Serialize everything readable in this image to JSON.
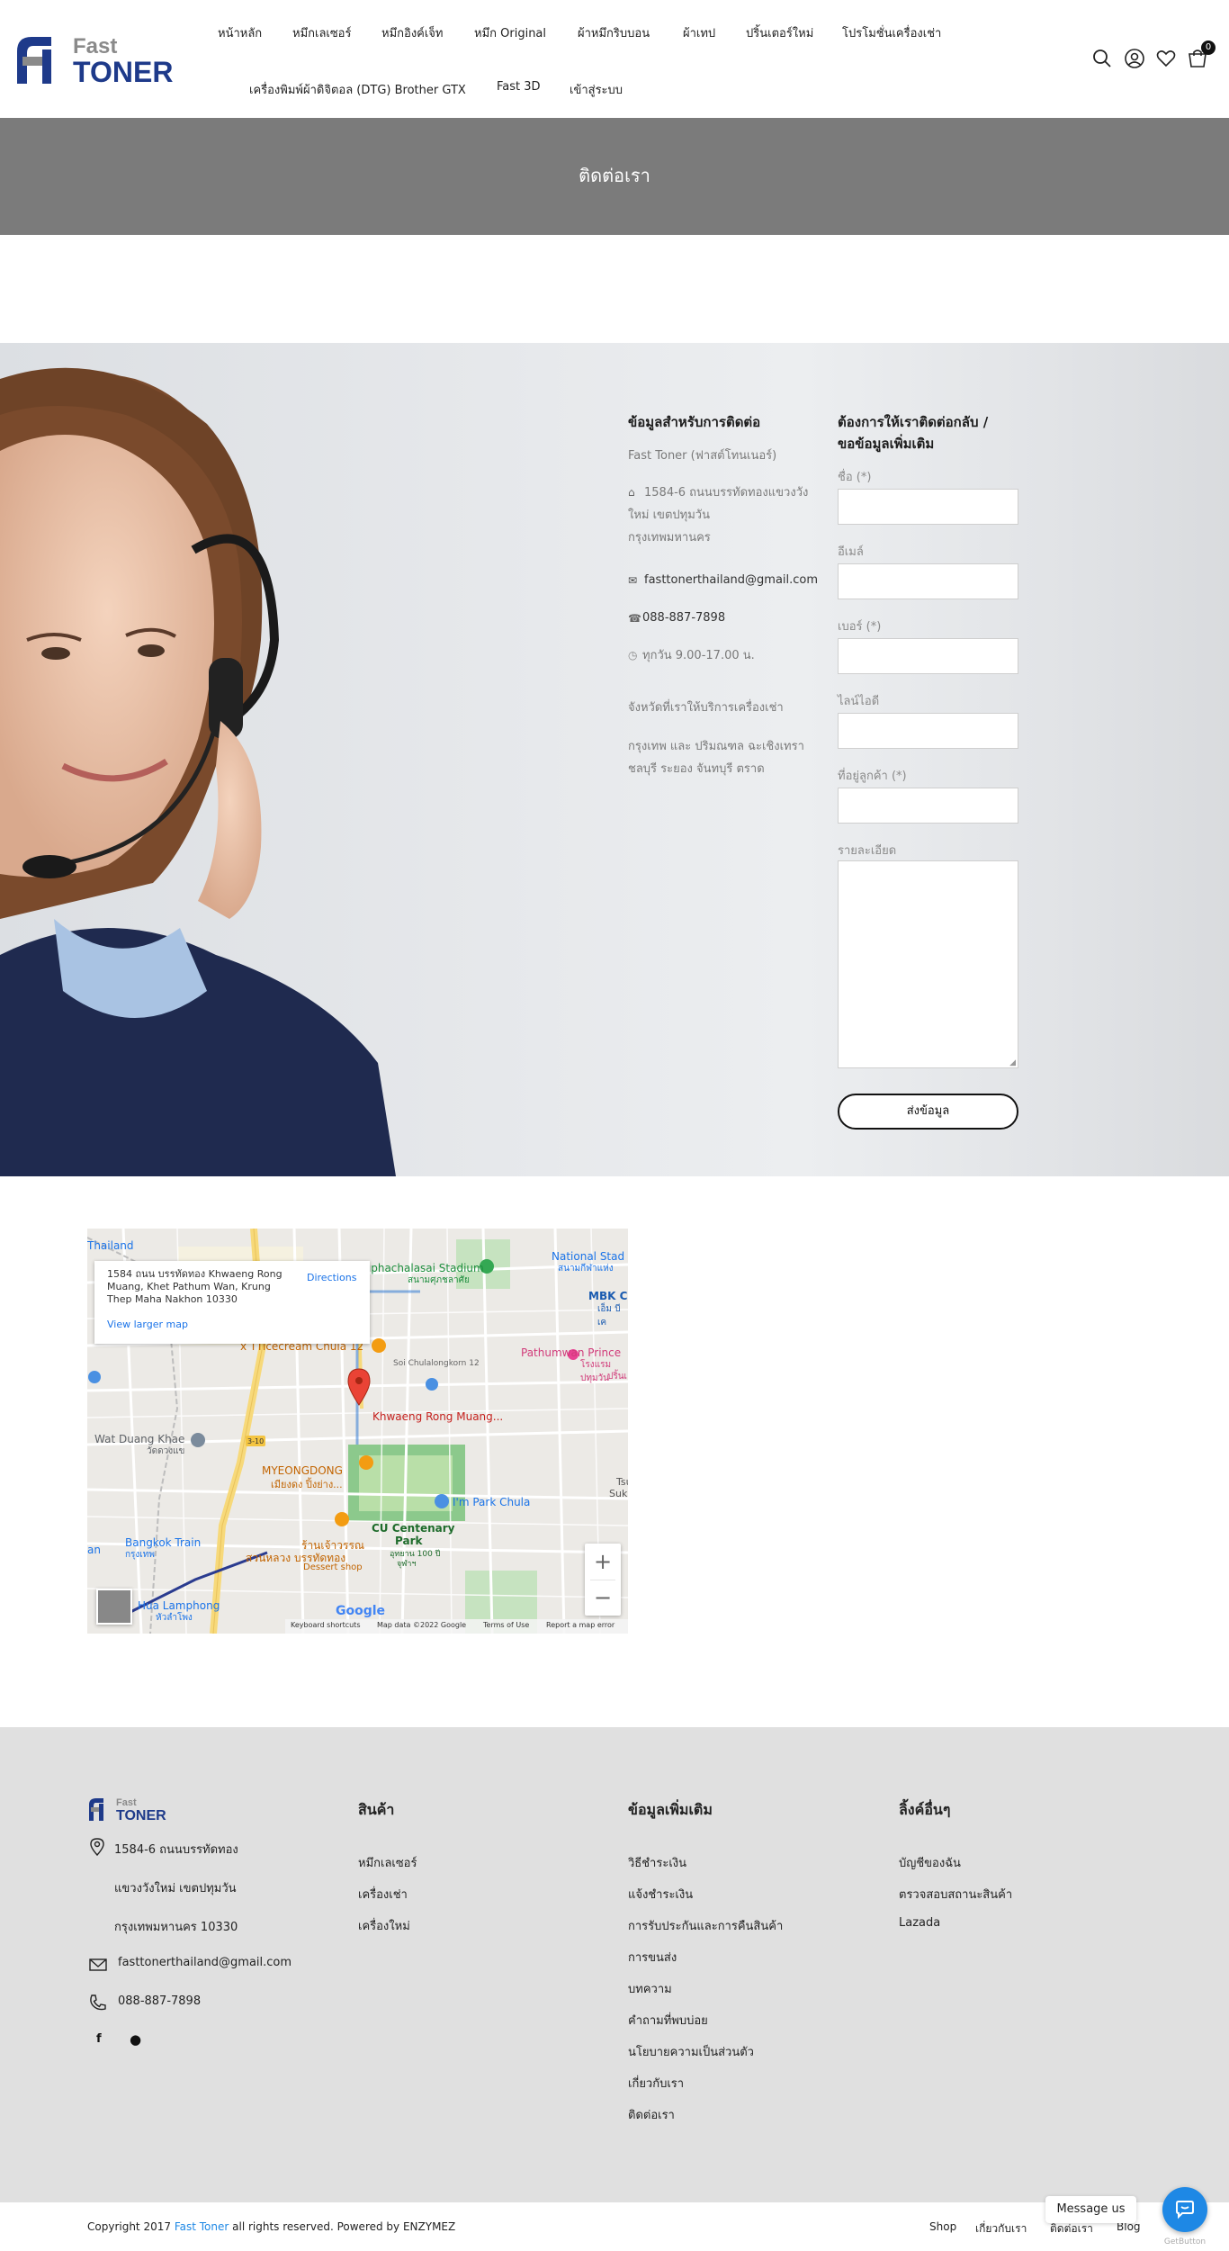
{
  "brand": {
    "logo_top": "Fast",
    "logo_bottom": "TONER",
    "accent": "#1e3a8a",
    "gray": "#8a8a8a"
  },
  "nav": {
    "row1": [
      "หน้าหลัก",
      "หมึกเลเซอร์",
      "หมึกอิงค์เจ็ท",
      "หมึก Original",
      "ผ้าหมึกริบบอน",
      "ผ้าเทป",
      "ปริ้นเตอร์ใหม่",
      "โปรโมชั่นเครื่องเช่า"
    ],
    "row2": [
      "เครื่องพิมพ์ผ้าดิจิตอล (DTG) Brother GTX",
      "Fast 3D",
      "เข้าสู่ระบบ"
    ],
    "cart_count": "0",
    "icons": [
      "search-icon",
      "user-icon",
      "heart-icon",
      "cart-icon"
    ]
  },
  "page_title": "ติดต่อเรา",
  "contact_info": {
    "heading": "ข้อมูลสำหรับการติดต่อ",
    "company": "Fast Toner (ฟาสต์โทนเนอร์)",
    "address_lines": [
      "1584-6 ถนนบรรทัดทองแขวงวัง",
      "ใหม่ เขตปทุมวัน",
      "กรุงเทพมหานคร"
    ],
    "email": "fasttonerthailand@gmail.com",
    "phone": "088-887-7898",
    "hours": "ทุกวัน 9.00-17.00 น.",
    "provinces_heading": "จังหวัดที่เราให้บริการเครื่องเช่า",
    "provinces_lines": [
      "กรุงเทพ และ ปริมณฑล ฉะเชิงเทรา",
      "ชลบุรี ระยอง จันทบุรี ตราด"
    ]
  },
  "form": {
    "heading_lines": [
      "ต้องการให้เราติดต่อกลับ /",
      "ขอข้อมูลเพิ่มเติม"
    ],
    "fields": [
      "ชื่อ (*)",
      "อีเมล์",
      "เบอร์ (*)",
      "ไลน์ไอดี",
      "ที่อยู่ลูกค้า (*)"
    ],
    "details_label": "รายละเอียด",
    "submit": "ส่งข้อมูล"
  },
  "map": {
    "place_address_lines": [
      "1584 ถนน บรรทัดทอง Khwaeng Rong",
      "Muang, Khet Pathum Wan, Krung",
      "Thep Maha Nakhon 10330"
    ],
    "directions": "Directions",
    "view_larger": "View larger map",
    "labels": {
      "thailand": "Thailand",
      "stadium": "Suphachalasai Stadium",
      "stadium_th": "สนามศุภชลาศัย",
      "national_stadium": "National Stad",
      "national_stadium_th": "สนามกีฬาแห่ง",
      "mbk": "MBK C",
      "mbk_th": "เอ็ม บี เค",
      "icecream": "x TTicecream Chula 12",
      "soi": "Soi Chulalongkorn 12",
      "pathumwan": "Pathumwan Prince",
      "pathumwan_th": "โรงแรมปทุมวัน",
      "pathumwan_th2": "ปริ้นเ",
      "marker": "Khwaeng Rong Muang...",
      "watduang": "Wat Duang Khae",
      "watduang_th": "วัดดวงแข",
      "road": "3-10",
      "myeongdong": "MYEONGDONG",
      "myeongdong_th": "เมียงดง ปิ้งย่าง...",
      "parkchula": "I'm Park Chula",
      "tsuk": "Tsu",
      "suk": "Suk",
      "cu_park1": "CU Centenary",
      "cu_park2": "Park",
      "cu_park_th": "อุทยาน 100 ปี",
      "cu_park_th2": "จุฬาฯ",
      "bkk_train": "Bangkok Train",
      "bkk_train_th": "กรุงเทพ",
      "an": "an",
      "dessert_th": "ร้านเจ้าวรรณ",
      "dessert_th2": "สวนหลวง บรรทัดทอง",
      "dessert": "Dessert shop",
      "hualamphong": "Hua Lamphong",
      "hualamphong_th": "หัวลำโพง",
      "google": "Google"
    },
    "footer_items": [
      "Keyboard shortcuts",
      "Map data ©2022 Google",
      "Terms of Use",
      "Report a map error"
    ],
    "zoom_in": "+",
    "zoom_out": "−"
  },
  "footer": {
    "logo_top": "Fast",
    "logo_bottom": "TONER",
    "address_lines": [
      "1584-6 ถนนบรรทัดทอง",
      "แขวงวังใหม่ เขตปทุมวัน",
      "กรุงเทพมหานคร 10330"
    ],
    "email": "fasttonerthailand@gmail.com",
    "phone": "088-887-7898",
    "col1": {
      "heading": "สินค้า",
      "links": [
        "หมึกเลเซอร์",
        "เครื่องเช่า",
        "เครื่องใหม่"
      ]
    },
    "col2": {
      "heading": "ข้อมูลเพิ่มเติม",
      "links": [
        "วิธีชำระเงิน",
        "แจ้งชำระเงิน",
        "การรับประกันและการคืนสินค้า",
        "การขนส่ง",
        "บทความ",
        "คำถามที่พบบ่อย",
        "นโยบายความเป็นส่วนตัว",
        "เกี่ยวกับเรา",
        "ติดต่อเรา"
      ]
    },
    "col3": {
      "heading": "ลิ้งค์อื่นๆ",
      "links": [
        "บัญชีของฉัน",
        "ตรวจสอบสถานะสินค้า",
        "Lazada"
      ]
    }
  },
  "bottom_bar": {
    "copyright_pre": "Copyright 2017",
    "copyright_brand": "Fast Toner",
    "copyright_post": "all rights reserved. Powered by ENZYMEZ",
    "links": [
      "Shop",
      "เกี่ยวกับเรา",
      "ติดต่อเรา",
      "Blog"
    ],
    "message_us": "Message us",
    "getbutton": "GetButton",
    "brand_color": "#1e88e5"
  }
}
